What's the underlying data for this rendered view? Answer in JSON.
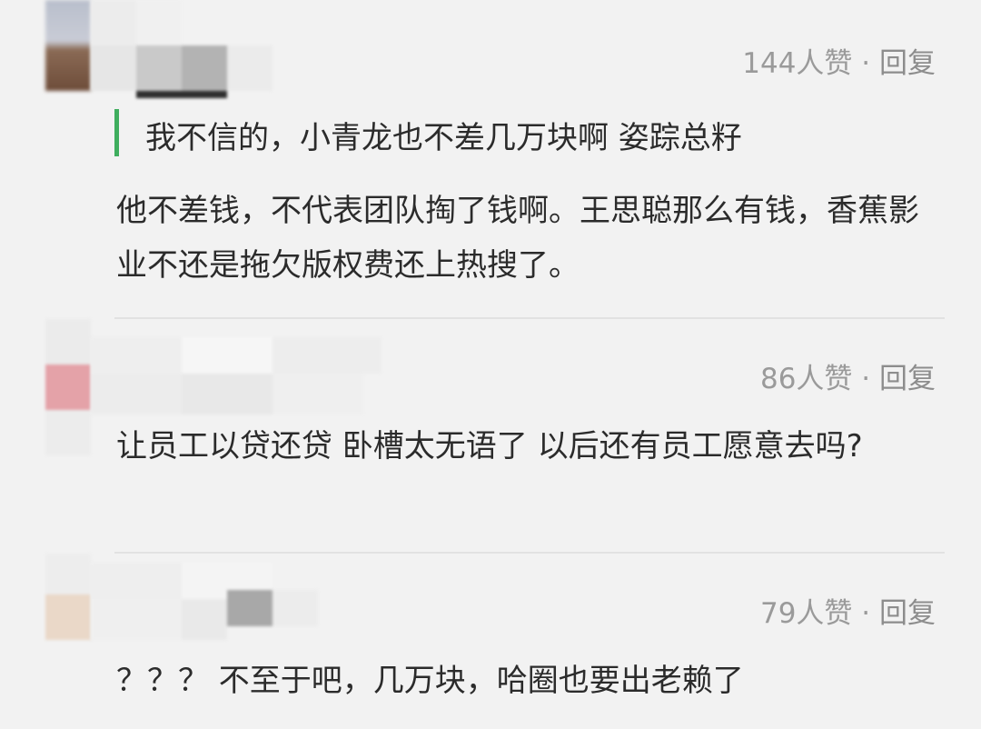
{
  "comments": [
    {
      "likes": "144人赞",
      "separator": "·",
      "reply": "回复",
      "quote": "我不信的，小青龙也不差几万块啊 姿踪总籽",
      "text": "他不差钱，不代表团队掏了钱啊。王思聪那么有钱，香蕉影业不还是拖欠版权费还上热搜了。"
    },
    {
      "likes": "86人赞",
      "separator": "·",
      "reply": "回复",
      "text": "让员工以贷还贷 卧槽太无语了 以后还有员工愿意去吗?"
    },
    {
      "likes": "79人赞",
      "separator": "·",
      "reply": "回复",
      "text": "？？？ 不至于吧，几万块，哈圈也要出老赖了"
    }
  ],
  "colors": {
    "background": "#f2f2f2",
    "quote_bar": "#3fae5e",
    "meta_text": "#9a9a9a",
    "body_text": "#2b2b2b"
  }
}
